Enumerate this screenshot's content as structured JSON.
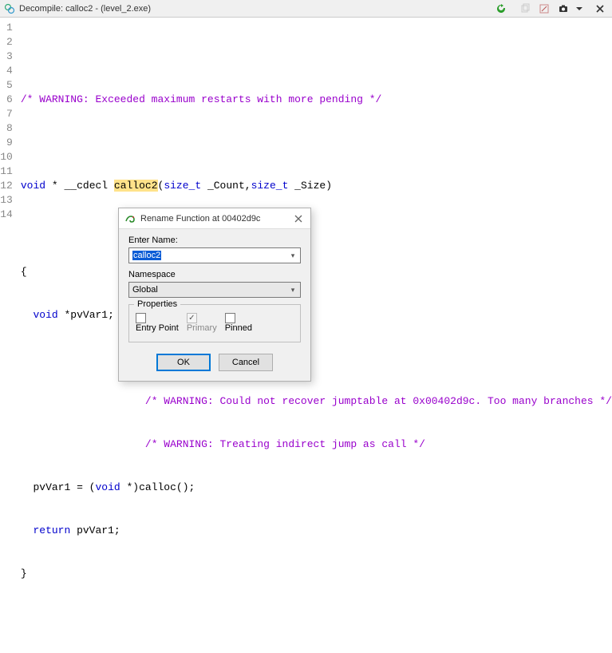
{
  "titlebar": {
    "title": "Decompile: calloc2 -  (level_2.exe)",
    "icons": {
      "refresh": "refresh-icon",
      "copy": "copy-icon",
      "edit": "edit-icon",
      "camera": "camera-icon",
      "dropdown": "dropdown-icon",
      "close": "close-icon"
    }
  },
  "code": {
    "lines": [
      "",
      "",
      "",
      "void * __cdecl calloc2(size_t _Count,size_t _Size)",
      "",
      "{",
      "  void *pvVar1;",
      "",
      "",
      "",
      "  pvVar1 = (void *)calloc();",
      "  return pvVar1;",
      "}",
      ""
    ],
    "warn1": "/* WARNING: Exceeded maximum restarts with more pending */",
    "warn2": "/* WARNING: Could not recover jumptable at 0x00402d9c. Too many branches */",
    "warn3": "/* WARNING: Treating indirect jump as call */",
    "sig_void": "void",
    "sig_star": " * ",
    "sig_cdecl": "__cdecl ",
    "sig_name": "calloc2",
    "sig_params_open": "(",
    "sig_p1t": "size_t",
    "sig_p1n": " _Count",
    "sig_comma": ",",
    "sig_p2t": "size_t",
    "sig_p2n": " _Size",
    "sig_params_close": ")",
    "decl_void": "void",
    "decl_rest": " *pvVar1;",
    "assign_lhs": "  pvVar1 = (",
    "assign_void": "void",
    "assign_mid": " *)calloc();",
    "ret_kw": "return",
    "ret_rest": " pvVar1;",
    "brace_open": "{",
    "brace_close": "}"
  },
  "dialog": {
    "title": "Rename Function at 00402d9c",
    "enter_name_label": "Enter Name:",
    "enter_name_value": "calloc2",
    "namespace_label": "Namespace",
    "namespace_value": "Global",
    "properties_label": "Properties",
    "entry_point": "Entry Point",
    "primary": "Primary",
    "pinned": "Pinned",
    "ok": "OK",
    "cancel": "Cancel"
  }
}
